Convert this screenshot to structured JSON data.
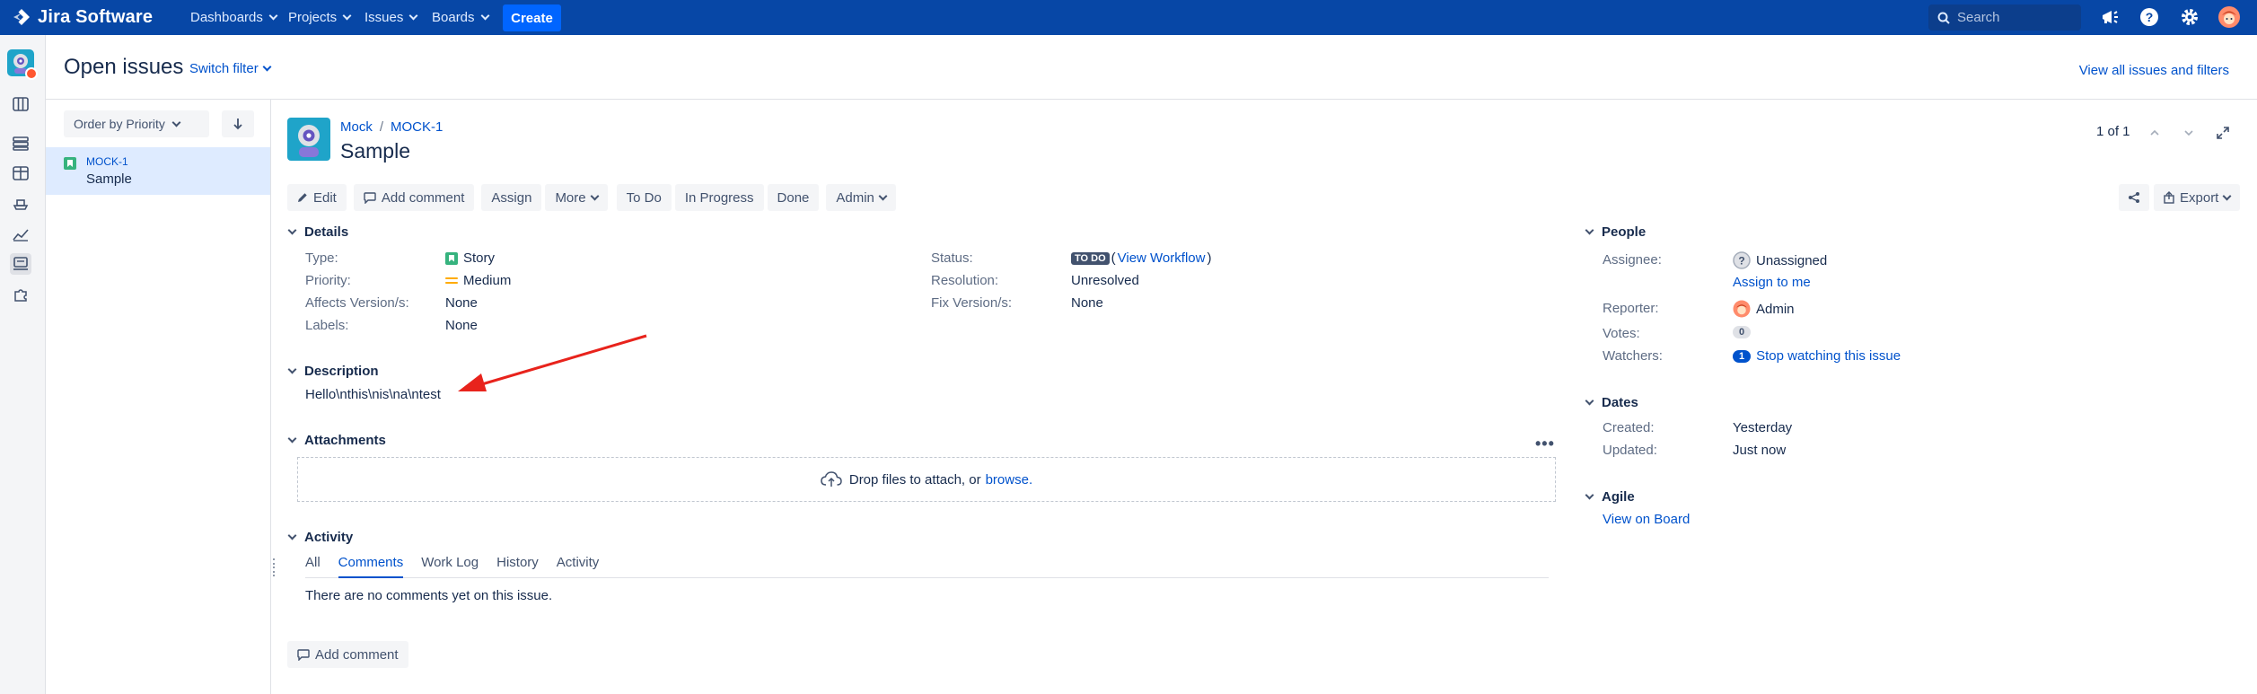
{
  "topnav": {
    "logo_text": "Jira Software",
    "items": [
      "Dashboards",
      "Projects",
      "Issues",
      "Boards"
    ],
    "create_label": "Create",
    "search_placeholder": "Search"
  },
  "header": {
    "title": "Open issues",
    "switch_filter": "Switch filter",
    "view_all": "View all issues and filters"
  },
  "list": {
    "order_label": "Order by Priority",
    "items": [
      {
        "key": "MOCK-1",
        "summary": "Sample"
      }
    ]
  },
  "issue": {
    "project": "Mock",
    "key": "MOCK-1",
    "summary": "Sample",
    "pager": "1 of 1",
    "toolbar": {
      "edit": "Edit",
      "add_comment": "Add comment",
      "assign": "Assign",
      "more": "More",
      "todo": "To Do",
      "in_progress": "In Progress",
      "done": "Done",
      "admin": "Admin",
      "export": "Export"
    },
    "details": {
      "heading": "Details",
      "type_label": "Type:",
      "type_value": "Story",
      "priority_label": "Priority:",
      "priority_value": "Medium",
      "affects_label": "Affects Version/s:",
      "affects_value": "None",
      "labels_label": "Labels:",
      "labels_value": "None",
      "status_label": "Status:",
      "status_value": "TO DO",
      "view_workflow": "View Workflow",
      "paren_open": "(",
      "paren_close": ")",
      "resolution_label": "Resolution:",
      "resolution_value": "Unresolved",
      "fix_label": "Fix Version/s:",
      "fix_value": "None"
    },
    "description": {
      "heading": "Description",
      "text": "Hello\\nthis\\nis\\na\\ntest"
    },
    "attachments": {
      "heading": "Attachments",
      "drop_text": "Drop files to attach, or",
      "browse": "browse."
    },
    "activity": {
      "heading": "Activity",
      "tabs": [
        "All",
        "Comments",
        "Work Log",
        "History",
        "Activity"
      ],
      "active_tab": "Comments",
      "empty": "There are no comments yet on this issue.",
      "add_comment": "Add comment"
    },
    "people": {
      "heading": "People",
      "assignee_label": "Assignee:",
      "assignee_value": "Unassigned",
      "assign_to_me": "Assign to me",
      "reporter_label": "Reporter:",
      "reporter_value": "Admin",
      "votes_label": "Votes:",
      "votes_value": "0",
      "watchers_label": "Watchers:",
      "watchers_count": "1",
      "stop_watching": "Stop watching this issue"
    },
    "dates": {
      "heading": "Dates",
      "created_label": "Created:",
      "created_value": "Yesterday",
      "updated_label": "Updated:",
      "updated_value": "Just now"
    },
    "agile": {
      "heading": "Agile",
      "view_on_board": "View on Board"
    }
  },
  "colors": {
    "nav_bg": "#0747a6",
    "create_bg": "#0065ff",
    "link": "#0052cc",
    "selected_row": "#deebff",
    "annotation_arrow": "#e8231c"
  }
}
